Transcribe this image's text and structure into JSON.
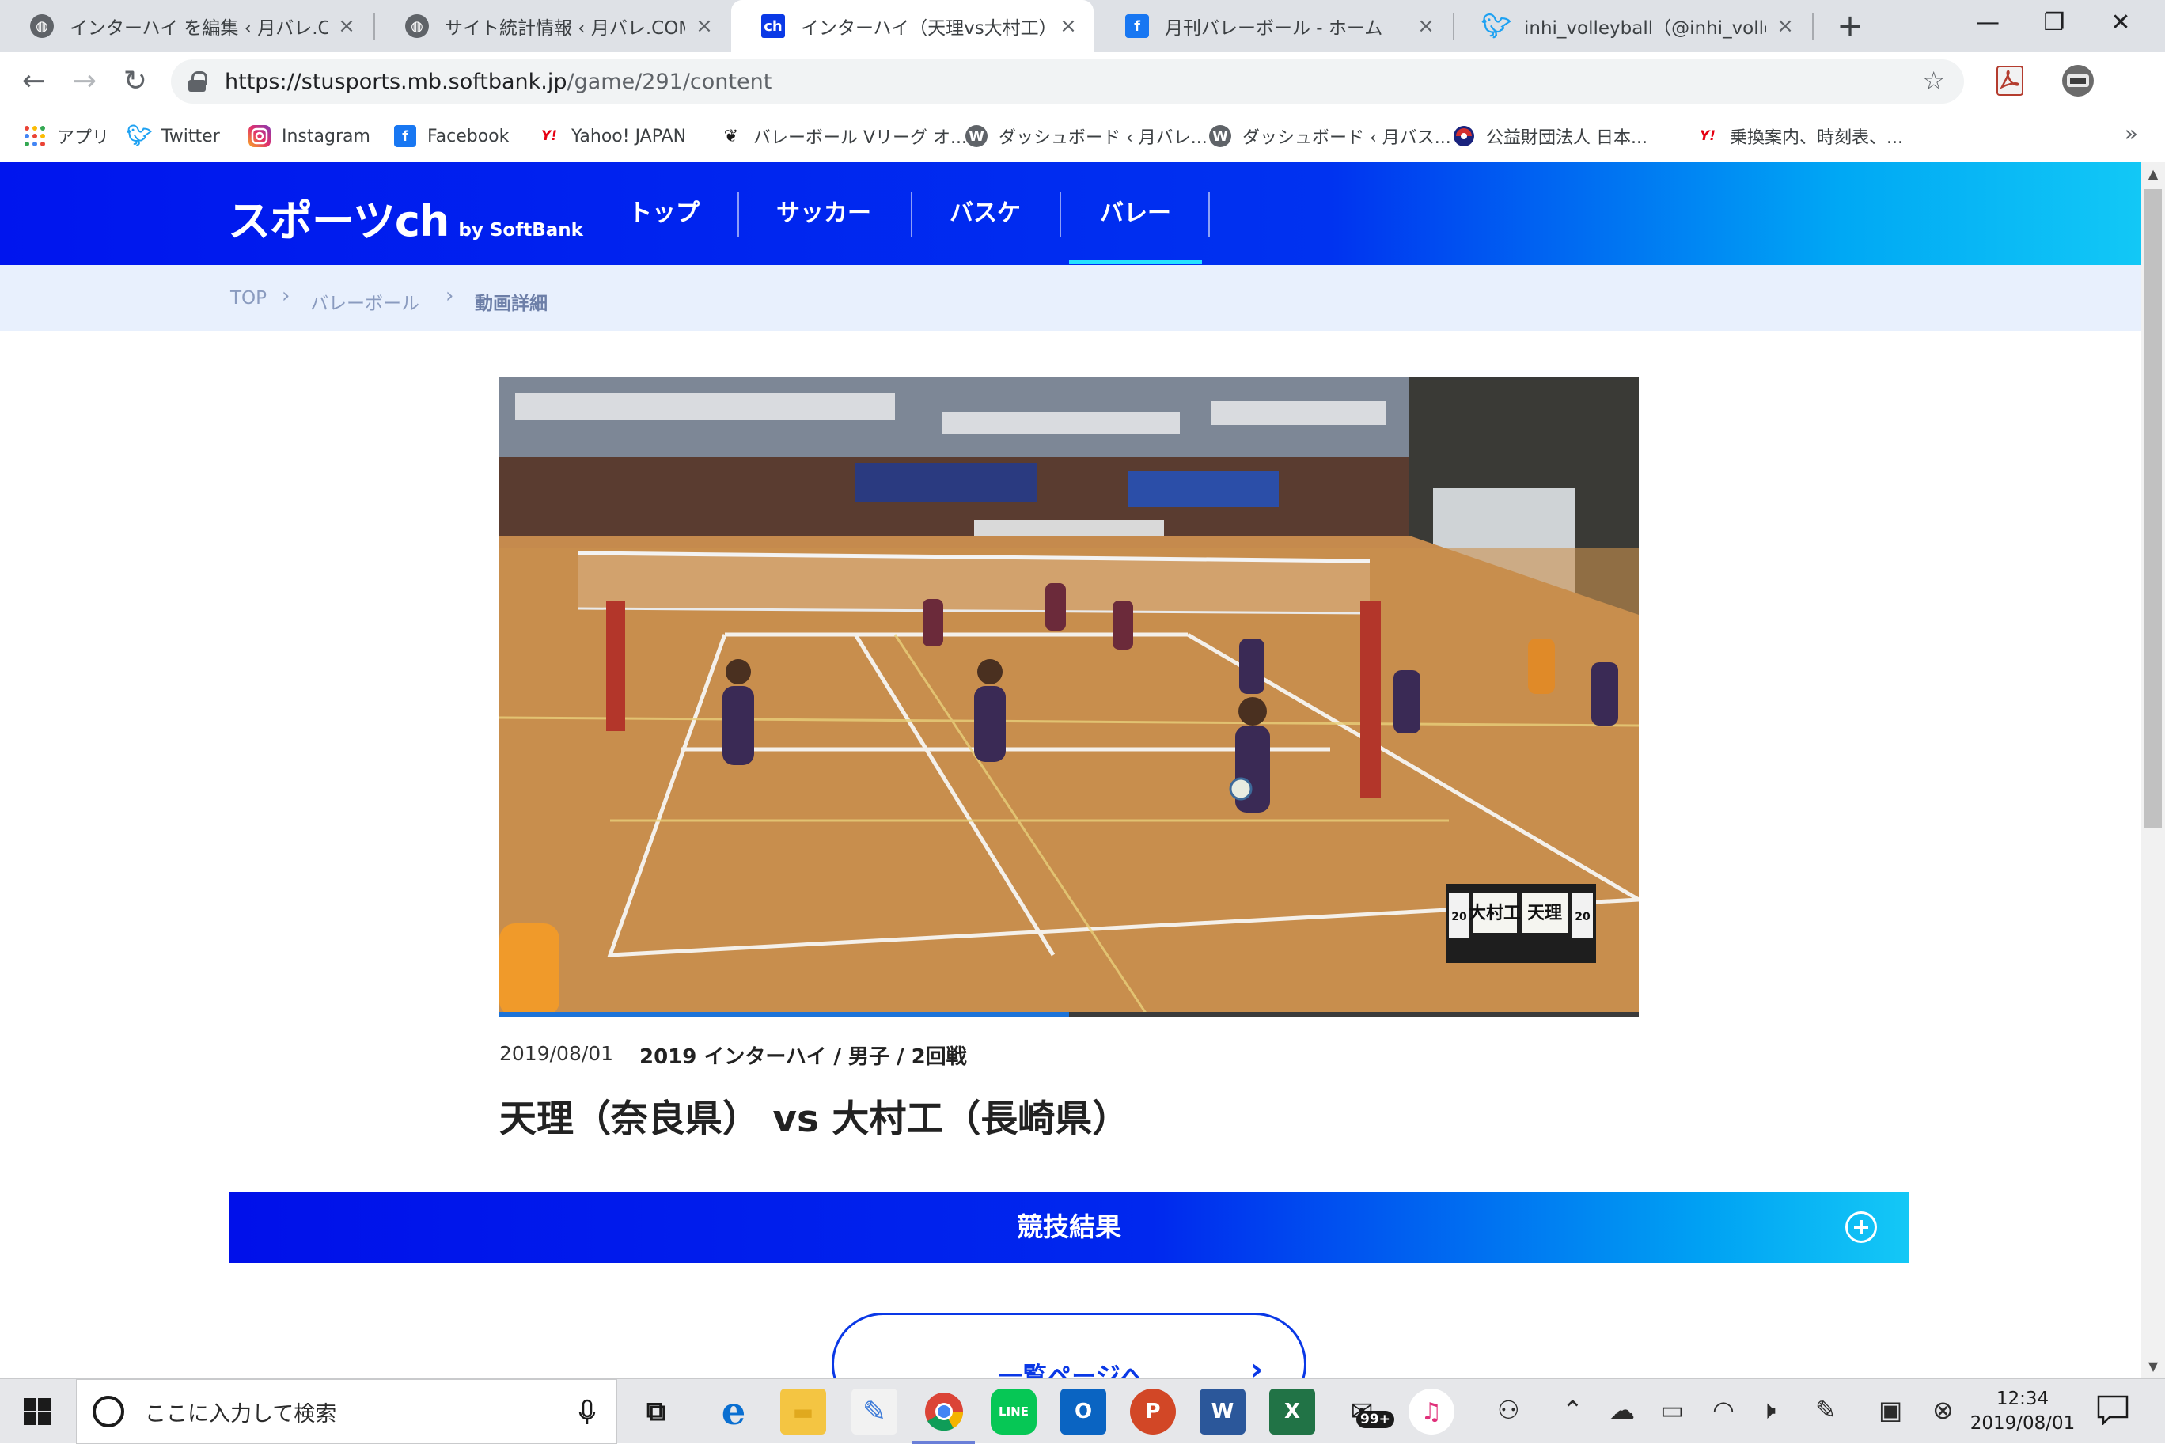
{
  "browser": {
    "tabs": [
      {
        "title": "インターハイ を編集 ‹ 月バレ.COM",
        "icon": "globe-icon"
      },
      {
        "title": "サイト統計情報 ‹ 月バレ.COM —",
        "icon": "globe-icon"
      },
      {
        "title": "インターハイ（天理vs大村工）の",
        "icon": "ch-icon",
        "favicon_text": "ch"
      },
      {
        "title": "月刊バレーボール - ホーム",
        "icon": "facebook-icon",
        "favicon_text": "f"
      },
      {
        "title": "inhi_volleyball（@inhi_volleyba",
        "icon": "twitter-icon"
      }
    ],
    "new_tab": "+",
    "window_controls": {
      "minimize": "—",
      "restore": "❐",
      "close": "✕"
    },
    "nav": {
      "back": "←",
      "forward": "→",
      "reload": "↻"
    },
    "url": {
      "host": "https://stusports.mb.softbank.jp",
      "path": "/game/291/content"
    },
    "bookmark_star": "☆",
    "bookmarks": [
      {
        "label": "アプリ",
        "icon": "apps-grid-icon"
      },
      {
        "label": "Twitter",
        "icon": "twitter-icon"
      },
      {
        "label": "Instagram",
        "icon": "instagram-icon"
      },
      {
        "label": "Facebook",
        "icon": "facebook-icon",
        "favicon_text": "f"
      },
      {
        "label": "Yahoo! JAPAN",
        "icon": "yahoo-icon",
        "favicon_text": "Y!"
      },
      {
        "label": "バレーボール Vリーグ オ...",
        "icon": "vleague-icon"
      },
      {
        "label": "ダッシュボード ‹ 月バレ...",
        "icon": "wordpress-icon"
      },
      {
        "label": "ダッシュボード ‹ 月バス...",
        "icon": "wordpress-icon"
      },
      {
        "label": "公益財団法人 日本...",
        "icon": "jva-icon"
      },
      {
        "label": "乗換案内、時刻表、...",
        "icon": "yahoo-icon",
        "favicon_text": "Y!"
      }
    ],
    "bookmarks_more": "»"
  },
  "site": {
    "logo_main": "スポーツch",
    "logo_by": "by SoftBank",
    "nav": [
      "トップ",
      "サッカー",
      "バスケ",
      "バレー"
    ],
    "active_nav": "バレー",
    "breadcrumb": [
      "TOP",
      "バレーボール",
      "動画詳細"
    ],
    "breadcrumb_sep": "›",
    "video": {
      "progress_fraction": 0.5,
      "scoreboard": {
        "team1": "大村工",
        "team2": "天理",
        "left_score": "20",
        "right_score": "20"
      }
    },
    "date": "2019/08/01",
    "tournament": "2019 インターハイ / 男子 / 2回戦",
    "match_title": "天理（奈良県） vs 大村工（長崎県）",
    "result_label": "競技結果",
    "list_button": "一覧ページへ"
  },
  "taskbar": {
    "search_placeholder": "ここに入力して検索",
    "badge": "99+",
    "clock_time": "12:34",
    "clock_date": "2019/08/01",
    "apps": [
      {
        "name": "task-view",
        "glyph": "⧉"
      },
      {
        "name": "edge",
        "glyph": "e"
      },
      {
        "name": "explorer",
        "glyph": "▬"
      },
      {
        "name": "paint",
        "glyph": "✎"
      },
      {
        "name": "chrome",
        "glyph": ""
      },
      {
        "name": "line",
        "glyph": "LINE"
      },
      {
        "name": "outlook",
        "glyph": "O"
      },
      {
        "name": "powerpoint",
        "glyph": "P"
      },
      {
        "name": "word",
        "glyph": "W"
      },
      {
        "name": "excel",
        "glyph": "X"
      },
      {
        "name": "mail-center",
        "glyph": "✉"
      },
      {
        "name": "itunes",
        "glyph": "♫"
      }
    ],
    "colors": {
      "accent": "#0a38e6",
      "gradient_end": "#14c8f6"
    }
  }
}
